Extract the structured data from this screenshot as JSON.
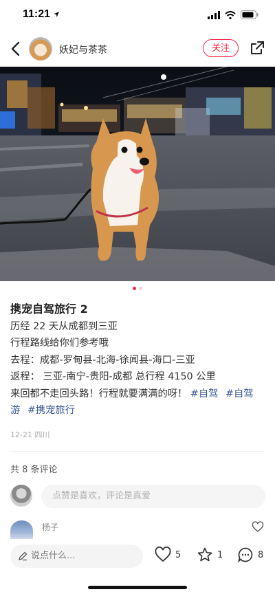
{
  "status_bar": {
    "time": "11:21"
  },
  "header": {
    "author": "妖妃与茶茶",
    "follow_label": "关注"
  },
  "post": {
    "title": "携宠自驾旅行 2",
    "lines": [
      "历经 22 天从成都到三亚",
      "行程路线给你们参考哦",
      "去程：成都-罗甸县-北海-徐闻县-海口-三亚",
      "返程： 三亚-南宁-贵阳-成都  总行程 4150 公里",
      "来回都不走回头路！行程就要满满的呀！"
    ],
    "tags": [
      "#自驾",
      "#自驾",
      "游",
      "#携宠旅行"
    ],
    "meta": "12-21 四川"
  },
  "comments": {
    "count_label": "共 8 条评论",
    "input_placeholder": "点赞是喜欢，评论是真爱",
    "first": {
      "name": "杨子"
    }
  },
  "bottom_bar": {
    "say_placeholder": "说点什么...",
    "likes": "5",
    "stars": "1",
    "comments": "8"
  },
  "colors": {
    "accent": "#ff2442",
    "tag": "#3b5998"
  }
}
